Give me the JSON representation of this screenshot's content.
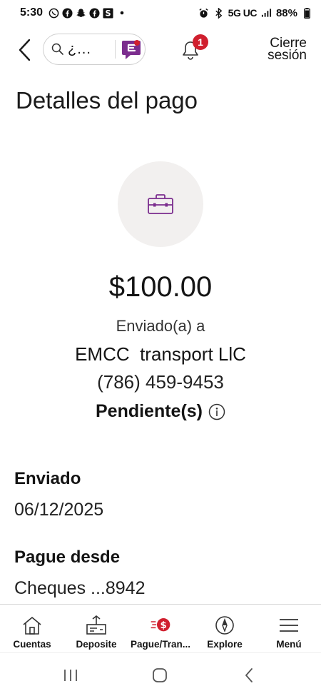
{
  "status_bar": {
    "time": "5:30",
    "network": "5G UC",
    "battery": "88%"
  },
  "header": {
    "search_placeholder": "¿...",
    "notification_count": "1",
    "logout_line1": "Cierre",
    "logout_line2": "sesión"
  },
  "page": {
    "title": "Detalles del pago"
  },
  "payment": {
    "amount": "$100.00",
    "sent_to_label": "Enviado(a) a",
    "recipient": "EMCC  transport LlC",
    "phone": "(786) 459-9453",
    "status": "Pendiente(s)"
  },
  "details": {
    "sent_label": "Enviado",
    "sent_date": "06/12/2025",
    "pay_from_label": "Pague desde",
    "pay_from_account": "Cheques ...8942"
  },
  "bottom_nav": {
    "items": [
      {
        "label": "Cuentas",
        "icon": "home-icon"
      },
      {
        "label": "Deposite",
        "icon": "deposit-icon"
      },
      {
        "label": "Pague/Tran...",
        "icon": "pay-transfer-icon"
      },
      {
        "label": "Explore",
        "icon": "compass-icon"
      },
      {
        "label": "Menú",
        "icon": "menu-icon"
      }
    ]
  },
  "colors": {
    "accent_red": "#d01f2e",
    "erica_purple": "#7b2d8e",
    "icon_circle_bg": "#f2f0ef"
  }
}
